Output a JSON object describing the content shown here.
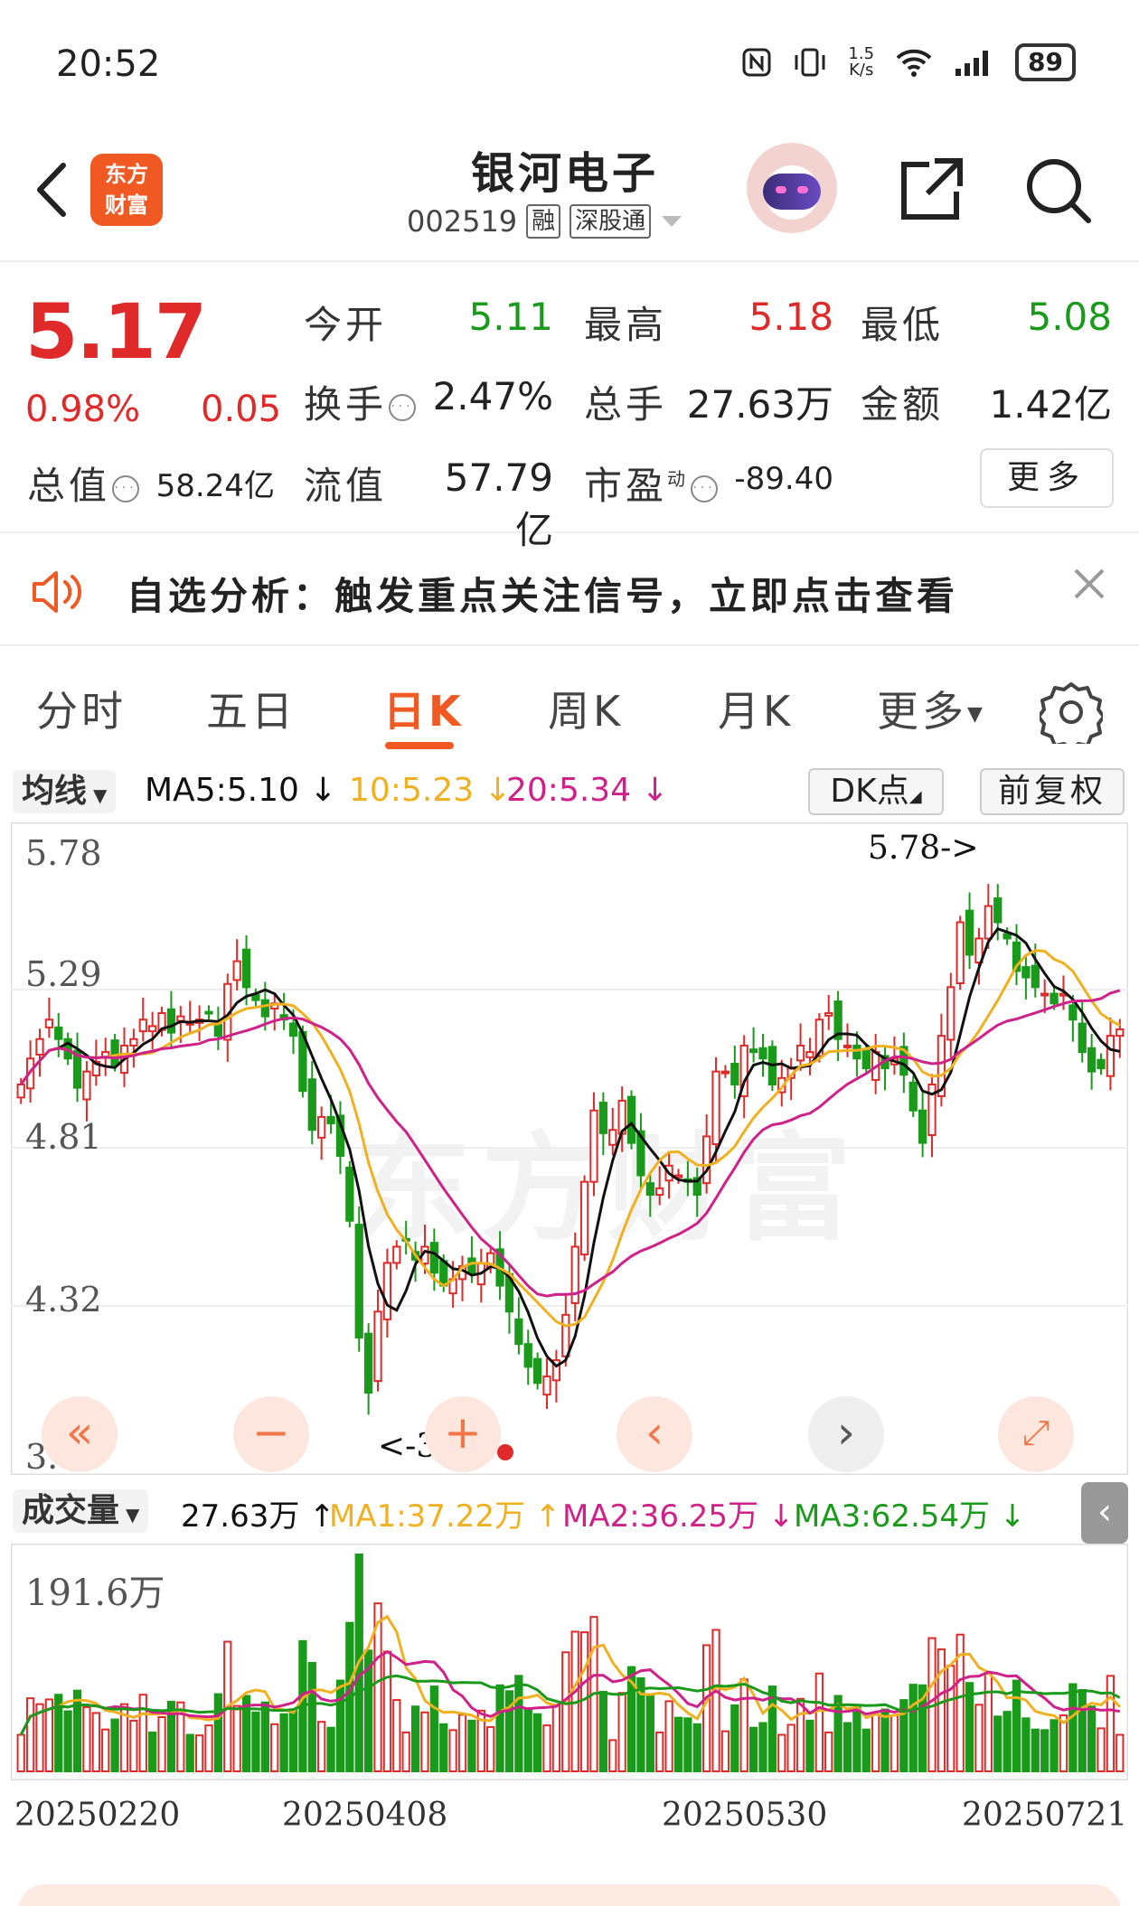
{
  "status_bar": {
    "time": "20:52",
    "net_speed": "1.5\nK/s",
    "battery": "89"
  },
  "header": {
    "logo_text": "东方\n财富",
    "title": "银河电子",
    "code": "002519",
    "tags": [
      "融",
      "深股通"
    ]
  },
  "quote": {
    "price": "5.17",
    "pct": "0.98%",
    "change": "0.05",
    "open_label": "今开",
    "open": "5.11",
    "high_label": "最高",
    "high": "5.18",
    "low_label": "最低",
    "low": "5.08",
    "turnover_label": "换手",
    "turnover": "2.47%",
    "volume_label": "总手",
    "volume": "27.63万",
    "amount_label": "金额",
    "amount": "1.42亿",
    "mktcap_label": "总值",
    "mktcap": "58.24亿",
    "float_label": "流值",
    "float": "57.79亿",
    "pe_label": "市盈",
    "pe_sup": "动",
    "pe": "-89.40",
    "more": "更多"
  },
  "notice": {
    "text": "自选分析：触发重点关注信号，立即点击查看"
  },
  "tabs": [
    "分时",
    "五日",
    "日K",
    "周K",
    "月K",
    "更多"
  ],
  "active_tab": "日K",
  "ma_bar": {
    "dropdown": "均线",
    "ma5": "MA5:5.10 ↓",
    "ma10": "10:5.23 ↓",
    "ma20": "20:5.34 ↓",
    "dk": "DK点",
    "adjust": "前复权"
  },
  "price_axis": [
    "5.78",
    "5.29",
    "4.81",
    "4.32",
    "3.83"
  ],
  "annotations": {
    "high": "5.78->",
    "low": "<-3.83"
  },
  "volume_bar": {
    "dropdown": "成交量",
    "current": "27.63万 ↑",
    "ma1": "MA1:37.22万 ↑",
    "ma2": "MA2:36.25万 ↓",
    "ma3": "MA3:62.54万 ↓",
    "axis_max": "191.6万"
  },
  "dates": [
    "20250220",
    "20250408",
    "20250530",
    "20250721"
  ],
  "colors": {
    "up": "#e02a2a",
    "down": "#1a9a1a",
    "ma5": "#111111",
    "ma10": "#f0b020",
    "ma20": "#d0208a",
    "accent": "#f05a22"
  },
  "chart_data": {
    "type": "candlestick",
    "ylim": [
      3.83,
      5.78
    ],
    "closes": [
      5.0,
      5.08,
      5.14,
      5.2,
      5.14,
      5.08,
      4.99,
      5.04,
      5.07,
      5.1,
      5.06,
      5.12,
      5.14,
      5.2,
      5.18,
      5.22,
      5.16,
      5.21,
      5.19,
      5.2,
      5.22,
      5.15,
      5.31,
      5.38,
      5.3,
      5.26,
      5.21,
      5.25,
      5.2,
      5.15,
      4.98,
      4.86,
      4.9,
      4.88,
      4.78,
      4.58,
      4.22,
      4.05,
      4.3,
      4.45,
      4.5,
      4.52,
      4.46,
      4.5,
      4.42,
      4.38,
      4.4,
      4.44,
      4.42,
      4.45,
      4.48,
      4.38,
      4.3,
      4.2,
      4.13,
      4.08,
      4.1,
      4.15,
      4.29,
      4.5,
      4.7,
      4.92,
      4.85,
      4.86,
      4.95,
      4.82,
      4.72,
      4.66,
      4.68,
      4.75,
      4.72,
      4.7,
      4.66,
      4.84,
      5.04,
      5.04,
      5.0,
      5.12,
      5.1,
      5.08,
      5.0,
      5.02,
      5.05,
      5.12,
      5.1,
      5.2,
      5.22,
      5.14,
      5.12,
      5.08,
      5.05,
      5.1,
      5.05,
      5.08,
      5.03,
      4.92,
      4.82,
      5.0,
      5.15,
      5.3,
      5.5,
      5.4,
      5.45,
      5.55,
      5.5,
      5.45,
      5.35,
      5.33,
      5.3,
      5.28,
      5.25,
      5.28,
      5.2,
      5.1,
      5.04,
      5.05,
      5.15,
      5.17
    ],
    "volume_max_label": "191.6万"
  }
}
